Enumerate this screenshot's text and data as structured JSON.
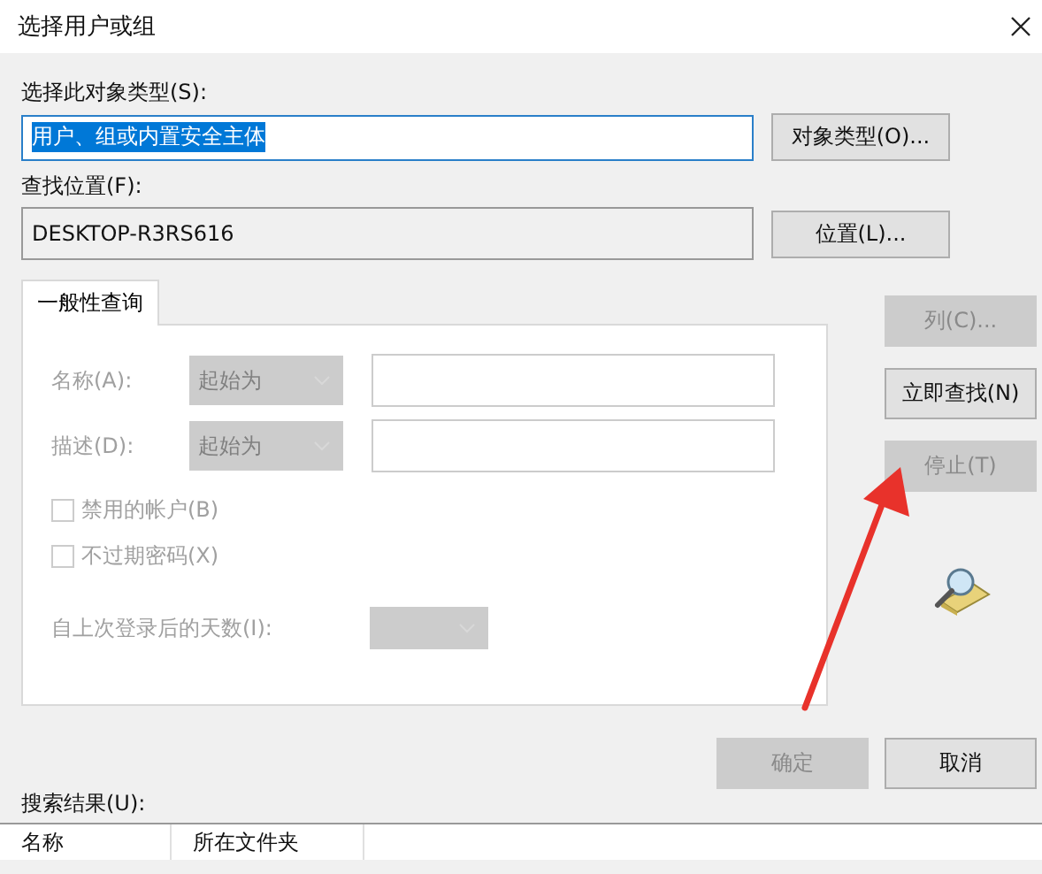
{
  "window": {
    "title": "选择用户或组"
  },
  "object_type": {
    "label": "选择此对象类型(S):",
    "value": "用户、组或内置安全主体",
    "value_selected": true,
    "button": "对象类型(O)..."
  },
  "location": {
    "label": "查找位置(F):",
    "value": "DESKTOP-R3RS616",
    "button": "位置(L)..."
  },
  "tabs": [
    {
      "label": "一般性查询",
      "selected": true
    }
  ],
  "query": {
    "fields": [
      {
        "label": "名称(A):",
        "operator": "起始为",
        "disabled": true
      },
      {
        "label": "描述(D):",
        "operator": "起始为",
        "disabled": true
      }
    ],
    "checkboxes": [
      {
        "label": "禁用的帐户(B)",
        "checked": false,
        "disabled": true
      },
      {
        "label": "不过期密码(X)",
        "checked": false,
        "disabled": true
      }
    ],
    "days": {
      "label": "自上次登录后的天数(I):",
      "disabled": true
    }
  },
  "side_buttons": [
    {
      "label": "列(C)...",
      "disabled": true
    },
    {
      "label": "立即查找(N)",
      "disabled": false
    },
    {
      "label": "停止(T)",
      "disabled": true
    }
  ],
  "buttons": [
    {
      "label": "确定",
      "disabled": true
    },
    {
      "label": "取消",
      "disabled": false
    }
  ],
  "results": {
    "label": "搜索结果(U):",
    "columns": [
      "名称",
      "所在文件夹"
    ]
  },
  "annotations": [
    {
      "kind": "arrow"
    }
  ]
}
